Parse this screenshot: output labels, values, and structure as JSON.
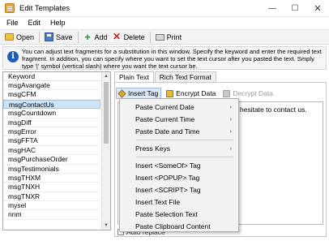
{
  "window": {
    "title": "Edit Templates",
    "min": "—",
    "max": "☐",
    "close": "✕"
  },
  "menu": [
    "File",
    "Edit",
    "Help"
  ],
  "toolbar": {
    "open": "Open",
    "save": "Save",
    "add": "Add",
    "delete": "Delete",
    "print": "Print"
  },
  "info": {
    "text": "You can adjust text fragments for a substitution in this window. Specify the keyword and enter the required text fragment. In addition, you can specify where you want to set the text cursor after you pasted the text. Smply type '|' symbol (vertical slash) where you want the text cursor be."
  },
  "keyword_list": {
    "header": "Keyword",
    "items": [
      "msgAvangate",
      "msgCFM",
      "msgContactUs",
      "msgCountdown",
      "msgDiff",
      "msgError",
      "msgFFTA",
      "msgHAC",
      "msgPurchaseOrder",
      "msgTestimonials",
      "msgTHXM",
      "msgTNXH",
      "msgTNXR",
      "mysel",
      "nnm"
    ],
    "selected": "msgContactUs"
  },
  "tabs": [
    "Plain Text",
    "Rich Text Format"
  ],
  "active_tab": "Plain Text",
  "editor": {
    "insert_tag": "Insert Tag",
    "encrypt": "Encrypt Data",
    "decrypt": "Decrypt Data",
    "content": "hesitate to contact us.",
    "auto_replace": "Auto replace"
  },
  "popup_menu": {
    "items": [
      {
        "label": "Paste Current Date",
        "submenu": true
      },
      {
        "label": "Paste Current Time",
        "submenu": true
      },
      {
        "label": "Paste Date and Time",
        "submenu": true
      },
      {
        "label": "Press Keys",
        "submenu": true
      },
      {
        "label": "Insert <SomeOf> Tag",
        "submenu": false
      },
      {
        "label": "Insert <POPUP> Tag",
        "submenu": false
      },
      {
        "label": "Insert <SCRIPT> Tag",
        "submenu": false
      },
      {
        "label": "Insert Text File",
        "submenu": false
      },
      {
        "label": "Paste Selection Text",
        "submenu": false
      },
      {
        "label": "Paste Clipboard Content",
        "submenu": false
      }
    ],
    "submenu_arrow": "›"
  }
}
